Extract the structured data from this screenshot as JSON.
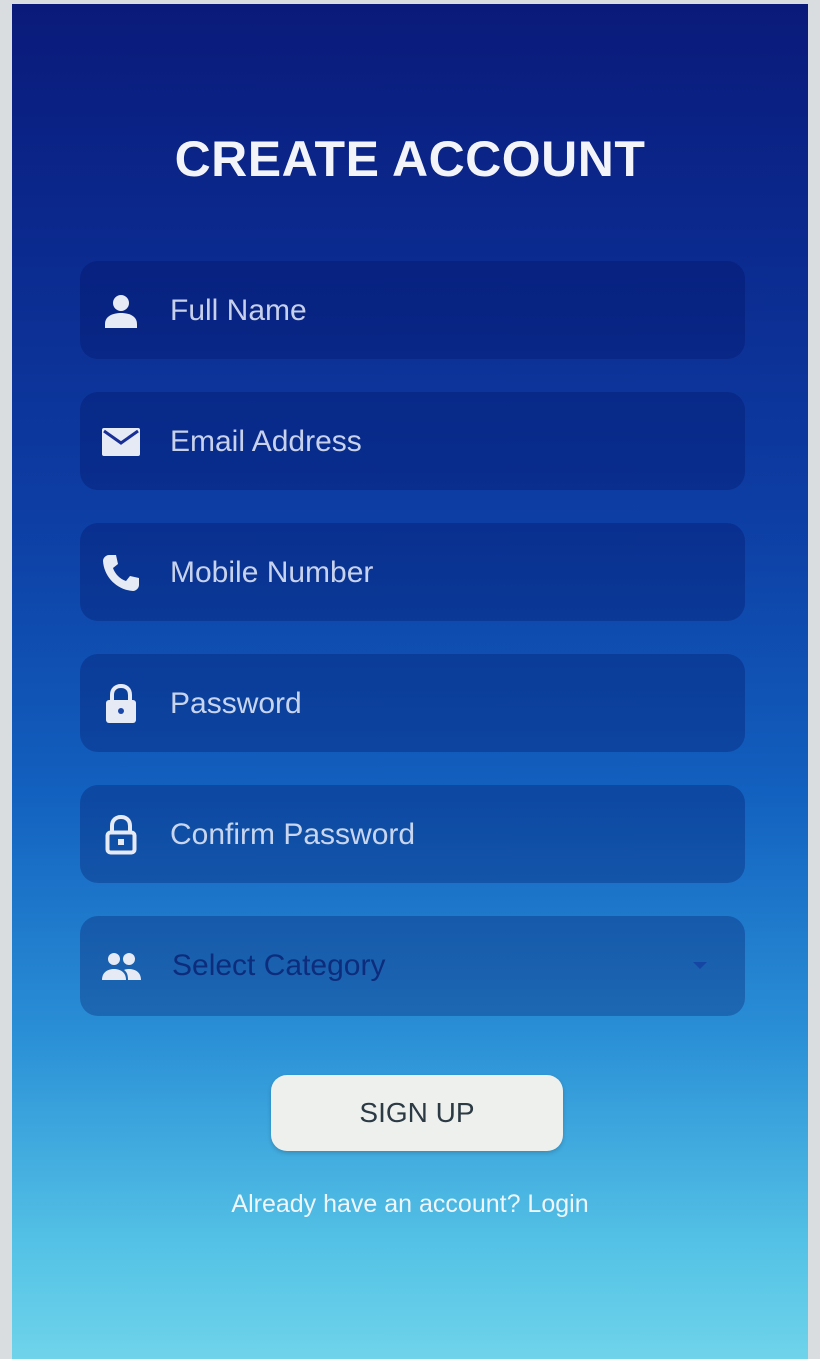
{
  "title": "CREATE ACCOUNT",
  "fields": {
    "full_name": {
      "placeholder": "Full Name",
      "icon": "person-icon"
    },
    "email": {
      "placeholder": "Email Address",
      "icon": "mail-icon"
    },
    "mobile": {
      "placeholder": "Mobile Number",
      "icon": "phone-icon"
    },
    "password": {
      "placeholder": "Password",
      "icon": "lock-icon"
    },
    "confirm_password": {
      "placeholder": "Confirm Password",
      "icon": "lock-outline-icon"
    }
  },
  "category": {
    "label": "Select Category",
    "icon": "group-icon"
  },
  "signup_label": "SIGN UP",
  "login_text": "Already have an account? Login",
  "colors": {
    "background_top": "#0a1a7a",
    "background_bottom": "#6fd3ea",
    "button": "#eef0ee",
    "text": "#f2f4fa"
  }
}
